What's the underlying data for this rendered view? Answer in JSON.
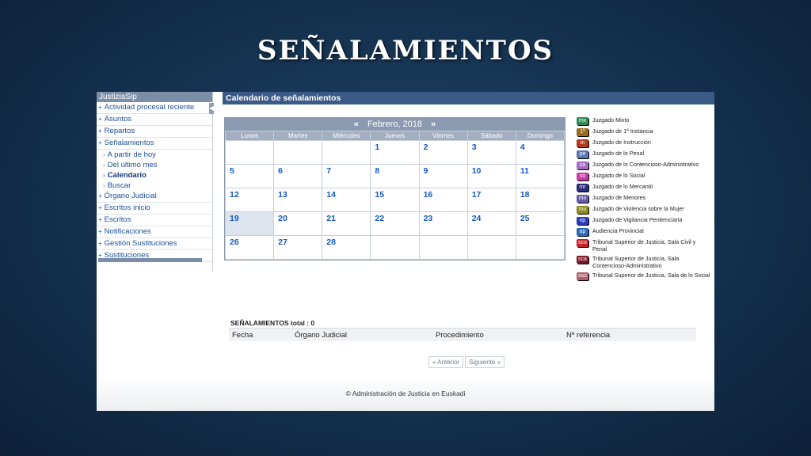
{
  "slide": {
    "title": "SEÑALAMIENTOS"
  },
  "sidebar": {
    "title": "JustiziaSip",
    "items": [
      {
        "label": "Actividad procesal reciente",
        "level": 0
      },
      {
        "label": "Asuntos",
        "level": 0
      },
      {
        "label": "Repartos",
        "level": 0
      },
      {
        "label": "Señalamientos",
        "level": 0
      },
      {
        "label": "A partir de hoy",
        "level": 1
      },
      {
        "label": "Del último mes",
        "level": 1
      },
      {
        "label": "Calendario",
        "level": 1,
        "active": true
      },
      {
        "label": "Buscar",
        "level": 1
      },
      {
        "label": "Órgano Judicial",
        "level": 0
      },
      {
        "label": "Escritos inicio",
        "level": 0
      },
      {
        "label": "Escritos",
        "level": 0
      },
      {
        "label": "Notificaciones",
        "level": 0
      },
      {
        "label": "Gestión Sustituciones",
        "level": 0
      },
      {
        "label": "Sustituciones",
        "level": 0
      }
    ]
  },
  "main": {
    "title": "Calendario de señalamientos"
  },
  "calendar": {
    "prev": "«",
    "month": "Febrero, 2018",
    "next": "»",
    "weekdays": [
      "Lunes",
      "Martes",
      "Miércoles",
      "Jueves",
      "Viernes",
      "Sábado",
      "Domingo"
    ],
    "weeks": [
      [
        "",
        "",
        "",
        "1",
        "2",
        "3",
        "4"
      ],
      [
        "5",
        "6",
        "7",
        "8",
        "9",
        "10",
        "11"
      ],
      [
        "12",
        "13",
        "14",
        "15",
        "16",
        "17",
        "18"
      ],
      [
        "19",
        "20",
        "21",
        "22",
        "23",
        "24",
        "25"
      ],
      [
        "26",
        "27",
        "28",
        "",
        "",
        "",
        ""
      ]
    ],
    "today": "19"
  },
  "legend": [
    {
      "code": "mx",
      "label": "Juzgado Mixto",
      "color": "#2e8b57"
    },
    {
      "code": "1ª",
      "label": "Juzgado de 1ª Instancia",
      "color": "#9a6a1e"
    },
    {
      "code": "in",
      "label": "Juzgado de Instrucción",
      "color": "#b23a1e"
    },
    {
      "code": "pe",
      "label": "Juzgado de lo Penal",
      "color": "#5a78b0"
    },
    {
      "code": "ca",
      "label": "Juzgado de lo Contencioso-Administrativo",
      "color": "#a36cc0"
    },
    {
      "code": "so",
      "label": "Juzgado de lo Social",
      "color": "#c93aa8"
    },
    {
      "code": "mr",
      "label": "Juzgado de lo Mercantil",
      "color": "#2a2a7a"
    },
    {
      "code": "mn",
      "label": "Juzgado de Menores",
      "color": "#6a5aa8"
    },
    {
      "code": "mu",
      "label": "Juzgado de Violencia sobre la Mujer",
      "color": "#8a8a1e"
    },
    {
      "code": "vp",
      "label": "Juzgado de Vigilancia Penitenciaria",
      "color": "#2a3ab8"
    },
    {
      "code": "ap",
      "label": "Audiencia Provincial",
      "color": "#2a6ab8"
    },
    {
      "code": "sco",
      "label": "Tribunal Superior de Justicia, Sala Civil y Penal",
      "color": "#c8202a"
    },
    {
      "code": "sca",
      "label": "Tribunal Superior de Justicia, Sala Contencioso-Administrativo",
      "color": "#7a1a2a"
    },
    {
      "code": "sso",
      "label": "Tribunal Superior de Justicia, Sala de lo Social",
      "color": "#b06070"
    }
  ],
  "results": {
    "total": "SEÑALAMIENTOS total : 0",
    "columns": [
      "Fecha",
      "Órgano Judicial",
      "Procedimiento",
      "Nº referencia"
    ],
    "prev_label": "« Anterior",
    "next_label": "Siguiente »"
  },
  "footer": "© Administración de Justicia en Euskadi"
}
